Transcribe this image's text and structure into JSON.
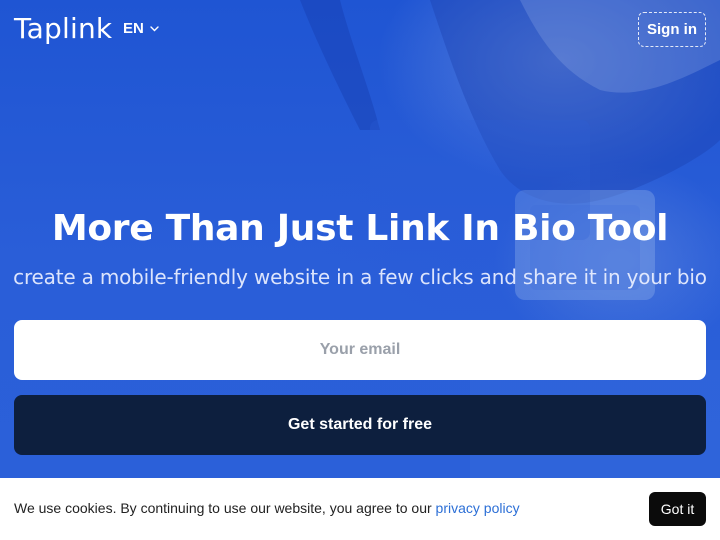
{
  "header": {
    "logo_text": "Taplink",
    "language": "EN",
    "signin_label": "Sign in"
  },
  "hero": {
    "headline": "More Than Just Link In Bio Tool",
    "subheadline": "create a mobile-friendly website in a few clicks and share it in your bio",
    "email_placeholder": "Your email",
    "email_value": "",
    "cta_label": "Get started for free"
  },
  "cookie_banner": {
    "text": "We use cookies. By continuing to use our website, you agree to our ",
    "link_text": "privacy policy",
    "accept_label": "Got it"
  },
  "colors": {
    "hero_blue": "#2458d6",
    "cta_navy": "#0d1f3e",
    "link_blue": "#2c6fd6",
    "button_black": "#0b0b0b"
  },
  "icons": {
    "language_dropdown": "chevron-down-icon"
  }
}
